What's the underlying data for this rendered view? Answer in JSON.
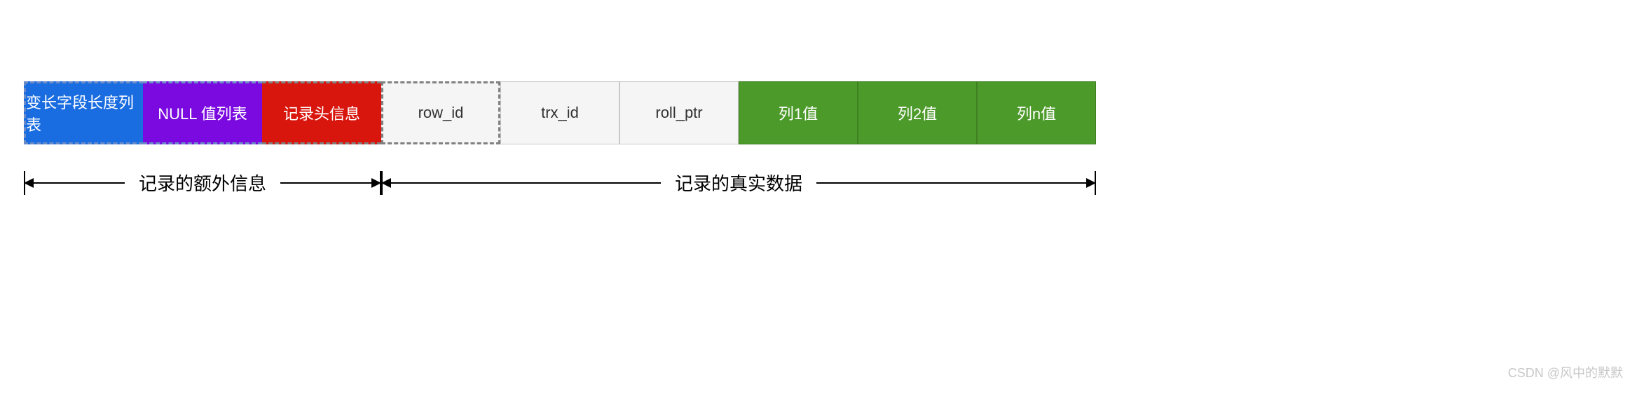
{
  "cells": {
    "varlen": "变长字段长度列表",
    "null_list": "NULL 值列表",
    "header_info": "记录头信息",
    "row_id": "row_id",
    "trx_id": "trx_id",
    "roll_ptr": "roll_ptr",
    "col1": "列1值",
    "col2": "列2值",
    "coln": "列n值"
  },
  "brackets": {
    "extra_info": "记录的额外信息",
    "real_data": "记录的真实数据"
  },
  "watermark": "CSDN @风中的默默",
  "colors": {
    "blue": "#1a6de0",
    "purple": "#7a0ae0",
    "red": "#d9160d",
    "gray_bg": "#f5f5f5",
    "green": "#4c9a2a"
  }
}
